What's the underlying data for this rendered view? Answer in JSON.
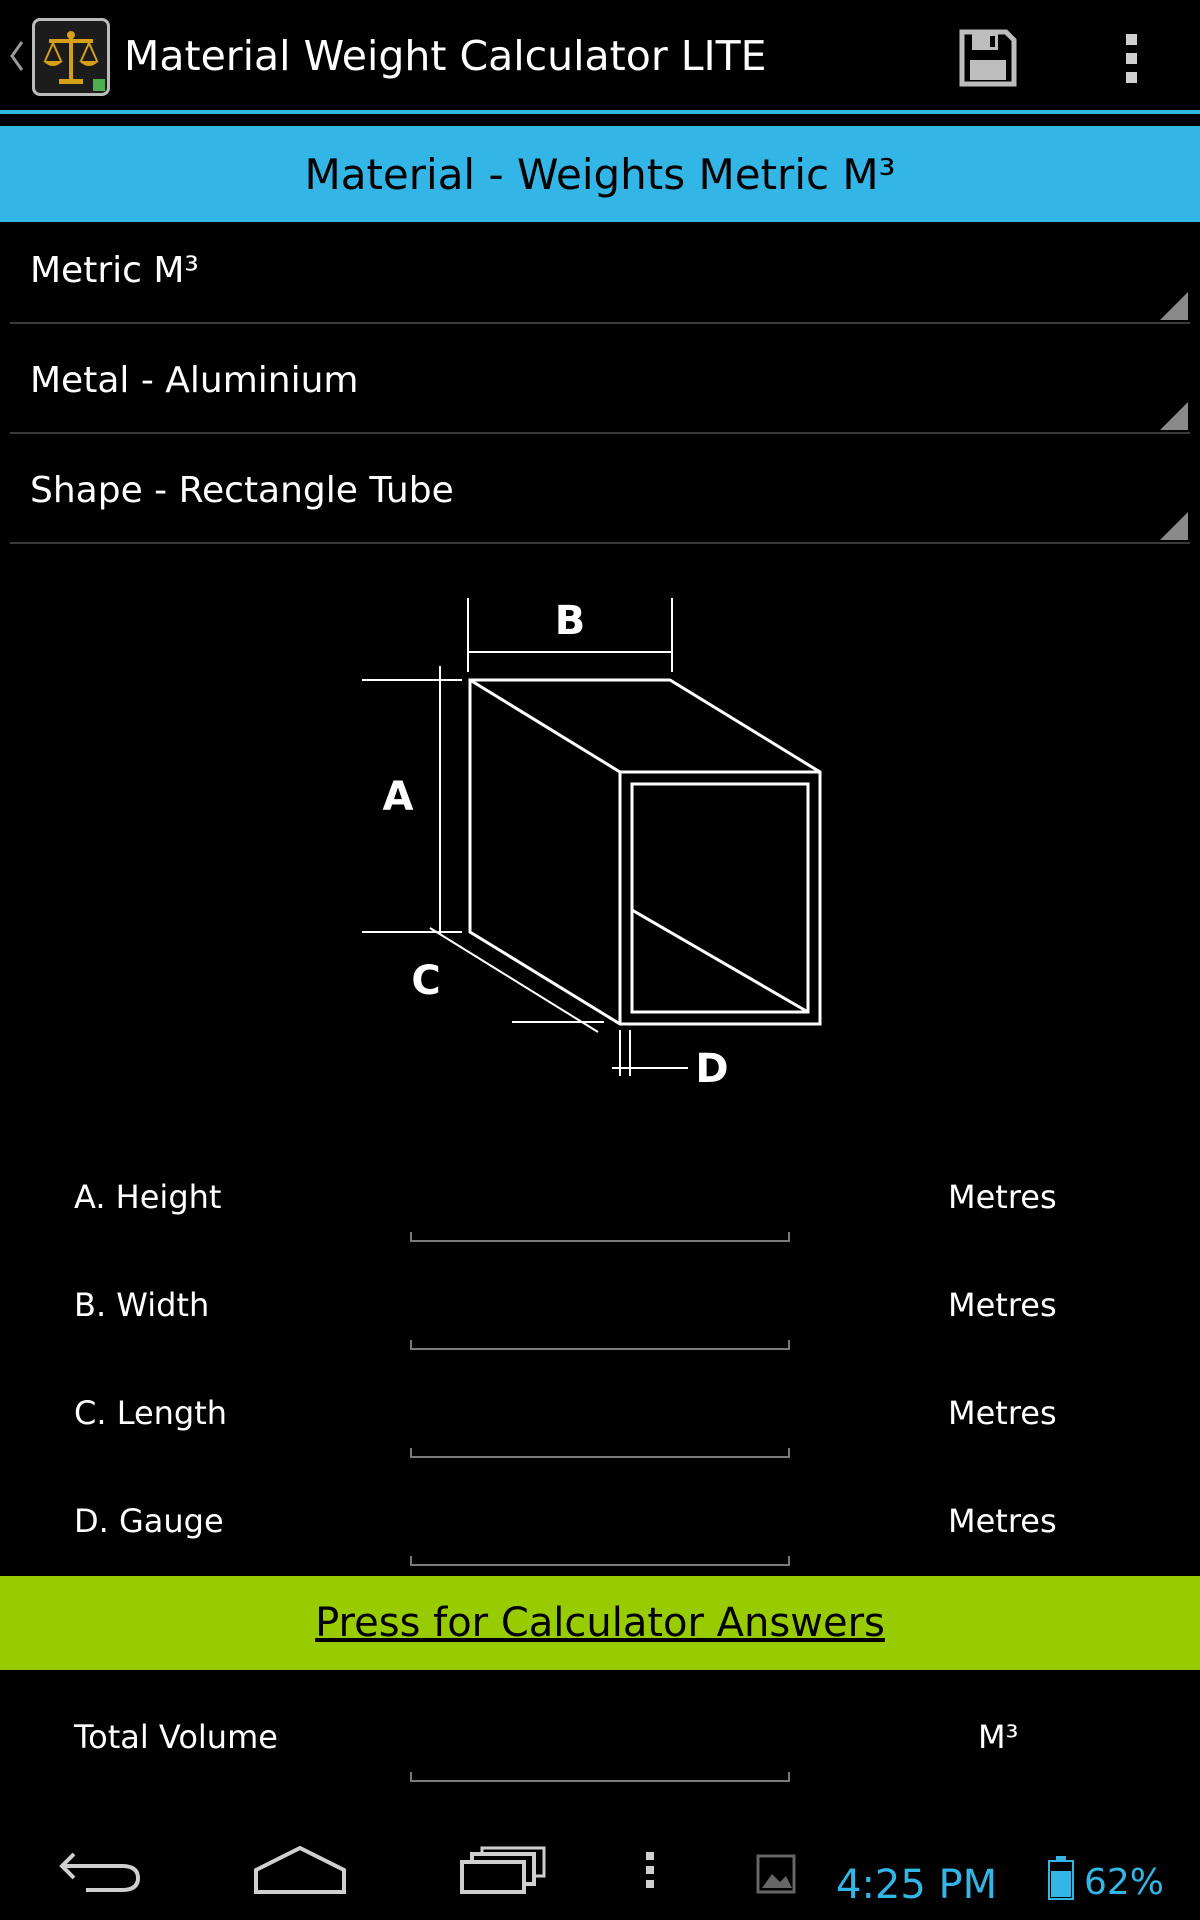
{
  "actionbar": {
    "title": "Material Weight Calculator LITE",
    "icons": [
      "back-caret-icon",
      "scales-app-icon",
      "save-icon",
      "overflow-menu-icon"
    ]
  },
  "header": {
    "title": "Material - Weights Metric M³"
  },
  "spinners": {
    "units": "Metric M³",
    "material": "Metal - Aluminium",
    "shape": "Shape - Rectangle Tube"
  },
  "diagram": {
    "label_a": "A",
    "label_b": "B",
    "label_c": "C",
    "label_d": "D"
  },
  "fields": {
    "height": {
      "label": "A. Height",
      "value": "",
      "unit": "Metres"
    },
    "width": {
      "label": "B. Width",
      "value": "",
      "unit": "Metres"
    },
    "length": {
      "label": "C. Length",
      "value": "",
      "unit": "Metres"
    },
    "gauge": {
      "label": "D. Gauge",
      "value": "",
      "unit": "Metres"
    }
  },
  "calculate": {
    "label": "Press for Calculator Answers"
  },
  "results": {
    "total_volume": {
      "label": "Total Volume",
      "value": "",
      "unit": "M³"
    }
  },
  "statusbar": {
    "time": "4:25 PM",
    "battery": "62%"
  },
  "colors": {
    "accent": "#33b5e5",
    "calc_button": "#99cc00",
    "background": "#000000"
  }
}
